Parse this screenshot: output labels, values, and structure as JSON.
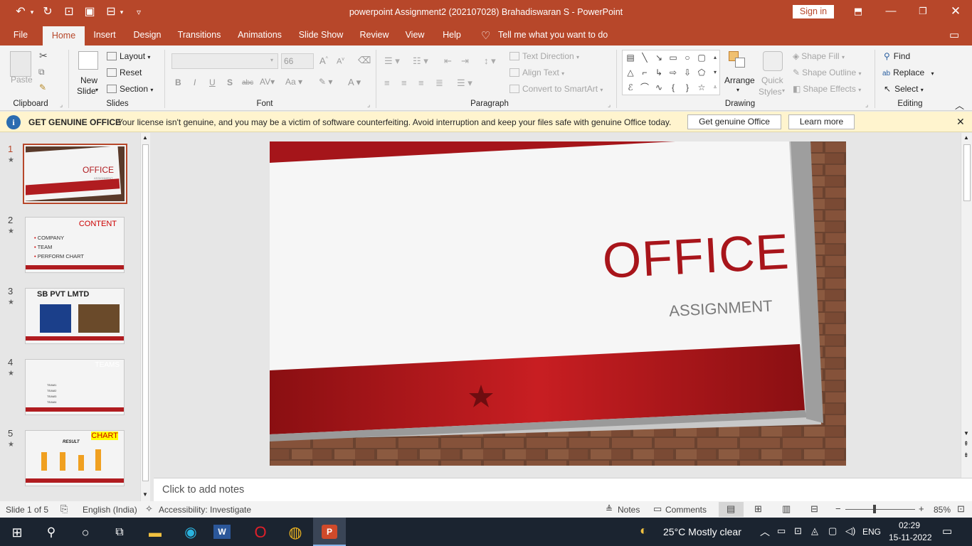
{
  "window": {
    "title": "powerpoint Assignment2 (202107028) Brahadiswaran S  -  PowerPoint",
    "sign_in": "Sign in"
  },
  "tabs": [
    "File",
    "Home",
    "Insert",
    "Design",
    "Transitions",
    "Animations",
    "Slide Show",
    "Review",
    "View",
    "Help"
  ],
  "tell_me": "Tell me what you want to do",
  "ribbon": {
    "clipboard": {
      "paste": "Paste",
      "label": "Clipboard"
    },
    "slides": {
      "new_slide_1": "New",
      "new_slide_2": "Slide",
      "layout": "Layout",
      "reset": "Reset",
      "section": "Section",
      "label": "Slides"
    },
    "font": {
      "font_size": "66",
      "label": "Font",
      "bold": "B",
      "italic": "I",
      "underline": "U",
      "shadow": "S",
      "strike": "abc"
    },
    "paragraph": {
      "text_direction": "Text Direction",
      "align_text": "Align Text",
      "smartart": "Convert to SmartArt",
      "label": "Paragraph"
    },
    "drawing": {
      "arrange": "Arrange",
      "quick_styles_1": "Quick",
      "quick_styles_2": "Styles",
      "shape_fill": "Shape Fill",
      "shape_outline": "Shape Outline",
      "shape_effects": "Shape Effects",
      "label": "Drawing"
    },
    "editing": {
      "find": "Find",
      "replace": "Replace",
      "select": "Select",
      "label": "Editing"
    }
  },
  "infobar": {
    "title": "GET GENUINE OFFICE",
    "message": "Your license isn't genuine, and you may be a victim of software counterfeiting. Avoid interruption and keep your files safe with genuine Office today.",
    "btn_genuine": "Get genuine Office",
    "btn_learn": "Learn more"
  },
  "thumbnails": [
    {
      "num": "1",
      "title": "OFFICE",
      "sub": "ASSIGNMENT"
    },
    {
      "num": "2",
      "title": "CONTENT",
      "items": [
        "COMPANY",
        "TEAM",
        "PERFORM CHART"
      ]
    },
    {
      "num": "3",
      "title": "SB PVT LMTD"
    },
    {
      "num": "4",
      "title": "TEAMS",
      "items": [
        "TEAM1",
        "TEAM2",
        "TEAM3",
        "TEAM4"
      ]
    },
    {
      "num": "5",
      "title": "CHART",
      "chart_title": "RESULT"
    }
  ],
  "slide": {
    "title": "OFFICE",
    "subtitle": "ASSIGNMENT"
  },
  "notes_placeholder": "Click to add notes",
  "status": {
    "slide_info": "Slide 1 of 5",
    "language": "English (India)",
    "accessibility": "Accessibility: Investigate",
    "notes": "Notes",
    "comments": "Comments",
    "zoom": "85%"
  },
  "taskbar": {
    "weather": "25°C  Mostly clear",
    "lang": "ENG",
    "time": "02:29",
    "date": "15-11-2022"
  },
  "colors": {
    "accent": "#b7472a",
    "slide_red": "#b01c20"
  }
}
